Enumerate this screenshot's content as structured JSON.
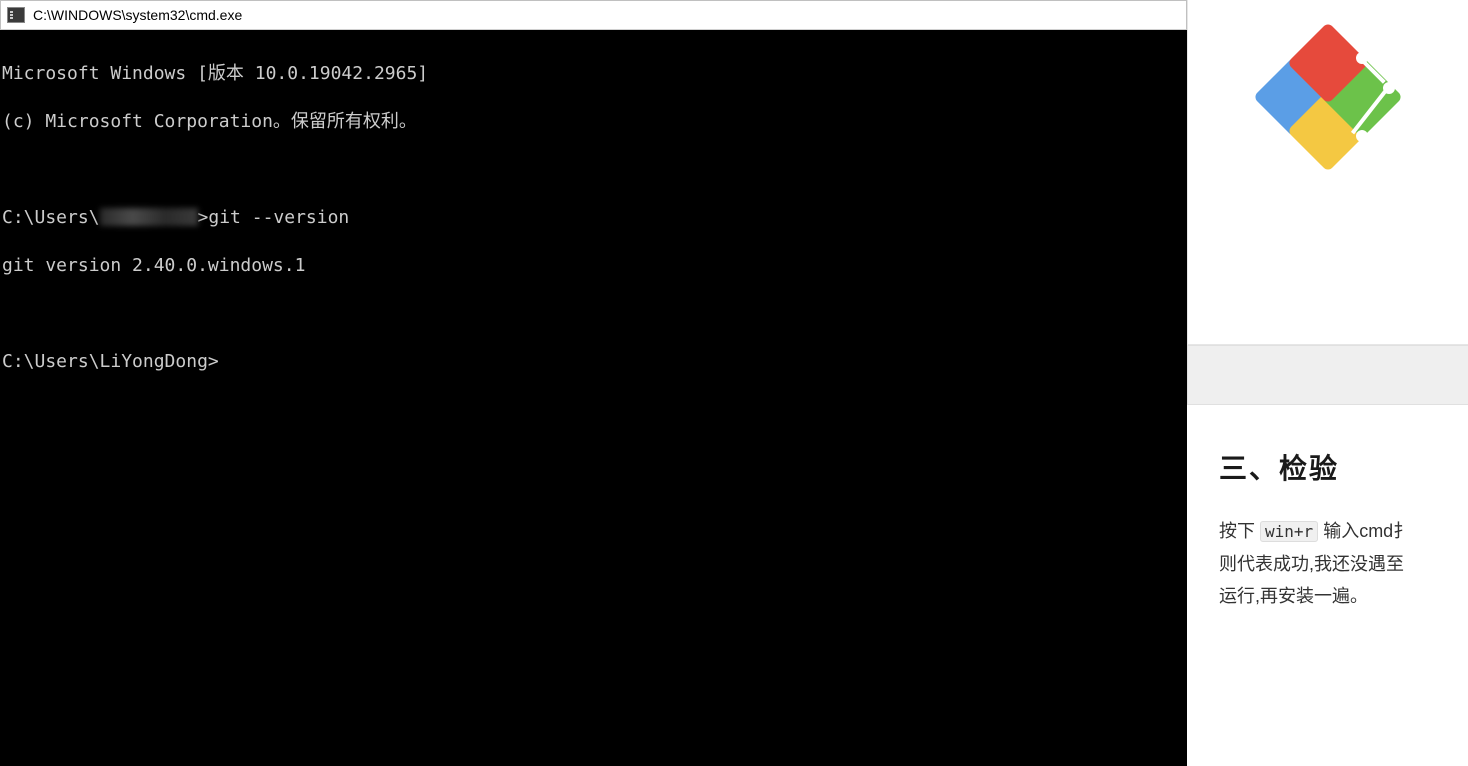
{
  "titlebar": {
    "title": "C:\\WINDOWS\\system32\\cmd.exe"
  },
  "terminal": {
    "line1": "Microsoft Windows [版本 10.0.19042.2965]",
    "line2": "(c) Microsoft Corporation。保留所有权利。",
    "prompt1_prefix": "C:\\Users\\",
    "prompt1_suffix": ">git --version",
    "output1": "git version 2.40.0.windows.1",
    "prompt2": "C:\\Users\\LiYongDong>"
  },
  "article": {
    "heading": "三、检验",
    "body_part1": "按下 ",
    "kbd": "win+r",
    "body_part2": " 输入cmd扌",
    "body_line2": "则代表成功,我还没遇至",
    "body_line3": "运行,再安装一遍。"
  }
}
